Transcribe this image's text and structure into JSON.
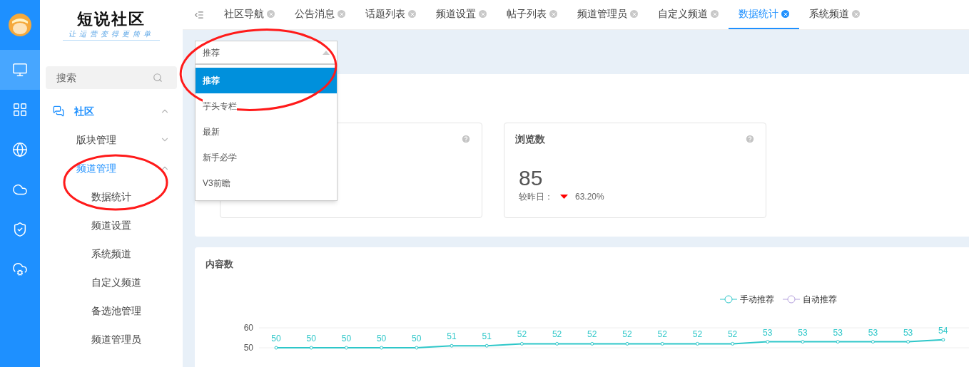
{
  "rail": {
    "items": [
      {
        "kind": "monitor",
        "selected": true
      },
      {
        "kind": "grid",
        "selected": false
      },
      {
        "kind": "globe",
        "selected": false
      },
      {
        "kind": "cloud",
        "selected": false
      },
      {
        "kind": "shield",
        "selected": false
      },
      {
        "kind": "cloud-gear",
        "selected": false
      }
    ]
  },
  "logo": {
    "title": "短说社区",
    "subtitle": "让运营变得更简单"
  },
  "search": {
    "placeholder": "搜索"
  },
  "menu": [
    {
      "label": "社区",
      "expanded": true,
      "selected": true,
      "children": [
        {
          "label": "版块管理",
          "expanded": false,
          "selected": false
        },
        {
          "label": "频道管理",
          "expanded": true,
          "selected": true,
          "children": [
            {
              "label": "数据统计",
              "selected": false
            },
            {
              "label": "频道设置",
              "selected": false
            },
            {
              "label": "系统频道",
              "selected": false
            },
            {
              "label": "自定义频道",
              "selected": false
            },
            {
              "label": "备选池管理",
              "selected": false
            },
            {
              "label": "频道管理员",
              "selected": false
            }
          ]
        }
      ]
    }
  ],
  "tabs": [
    {
      "label": "社区导航",
      "selected": false
    },
    {
      "label": "公告消息",
      "selected": false
    },
    {
      "label": "话题列表",
      "selected": false
    },
    {
      "label": "频道设置",
      "selected": false
    },
    {
      "label": "帖子列表",
      "selected": false
    },
    {
      "label": "频道管理员",
      "selected": false
    },
    {
      "label": "自定义频道",
      "selected": false
    },
    {
      "label": "数据统计",
      "selected": true
    },
    {
      "label": "系统频道",
      "selected": false
    }
  ],
  "select": {
    "value": "推荐",
    "options": [
      {
        "label": "推荐",
        "selected": true
      },
      {
        "label": "芋头专栏",
        "selected": false
      },
      {
        "label": "最新",
        "selected": false
      },
      {
        "label": "新手必学",
        "selected": false
      },
      {
        "label": "V3前瞻",
        "selected": false
      }
    ]
  },
  "stat_cards": [
    {
      "kind": "covered"
    },
    {
      "kind": "full",
      "title": "浏览数",
      "value": "85",
      "change_label": "较昨日：",
      "decreased": true,
      "change": "63.20%"
    }
  ],
  "chart_card": {
    "title": "内容数",
    "chart_data": {
      "type": "line",
      "ylim": [
        50,
        60
      ],
      "yticks": [
        50,
        60
      ],
      "data_labels": true,
      "series": [
        {
          "name": "手动推荐",
          "color": "#2ec7c9",
          "marker": "o",
          "values": [
            50,
            50,
            50,
            50,
            50,
            51,
            51,
            52,
            52,
            52,
            52,
            52,
            52,
            52,
            53,
            53,
            53,
            53,
            53,
            54
          ]
        },
        {
          "name": "自动推荐",
          "color": "#b6a2de"
        }
      ]
    }
  },
  "annotations": [
    {
      "kind": "ellipse"
    },
    {
      "kind": "ellipse"
    }
  ]
}
